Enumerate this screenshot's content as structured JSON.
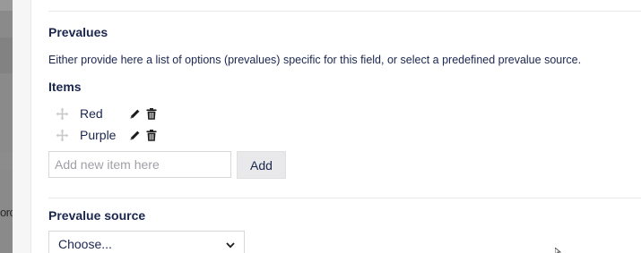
{
  "backdrop": {
    "text_fragment": "orc"
  },
  "prevalues": {
    "title": "Prevalues",
    "description": "Either provide here a list of options (prevalues) specific for this field, or select a predefined prevalue source.",
    "items_label": "Items",
    "items": [
      {
        "label": "Red"
      },
      {
        "label": "Purple"
      }
    ],
    "new_item_placeholder": "Add new item here",
    "add_label": "Add"
  },
  "prevalue_source": {
    "label": "Prevalue source",
    "selected": "Choose..."
  },
  "icons": {
    "drag": "drag-handle-icon",
    "edit": "pencil-icon",
    "delete": "trash-icon",
    "dropdown": "chevron-down-icon"
  }
}
